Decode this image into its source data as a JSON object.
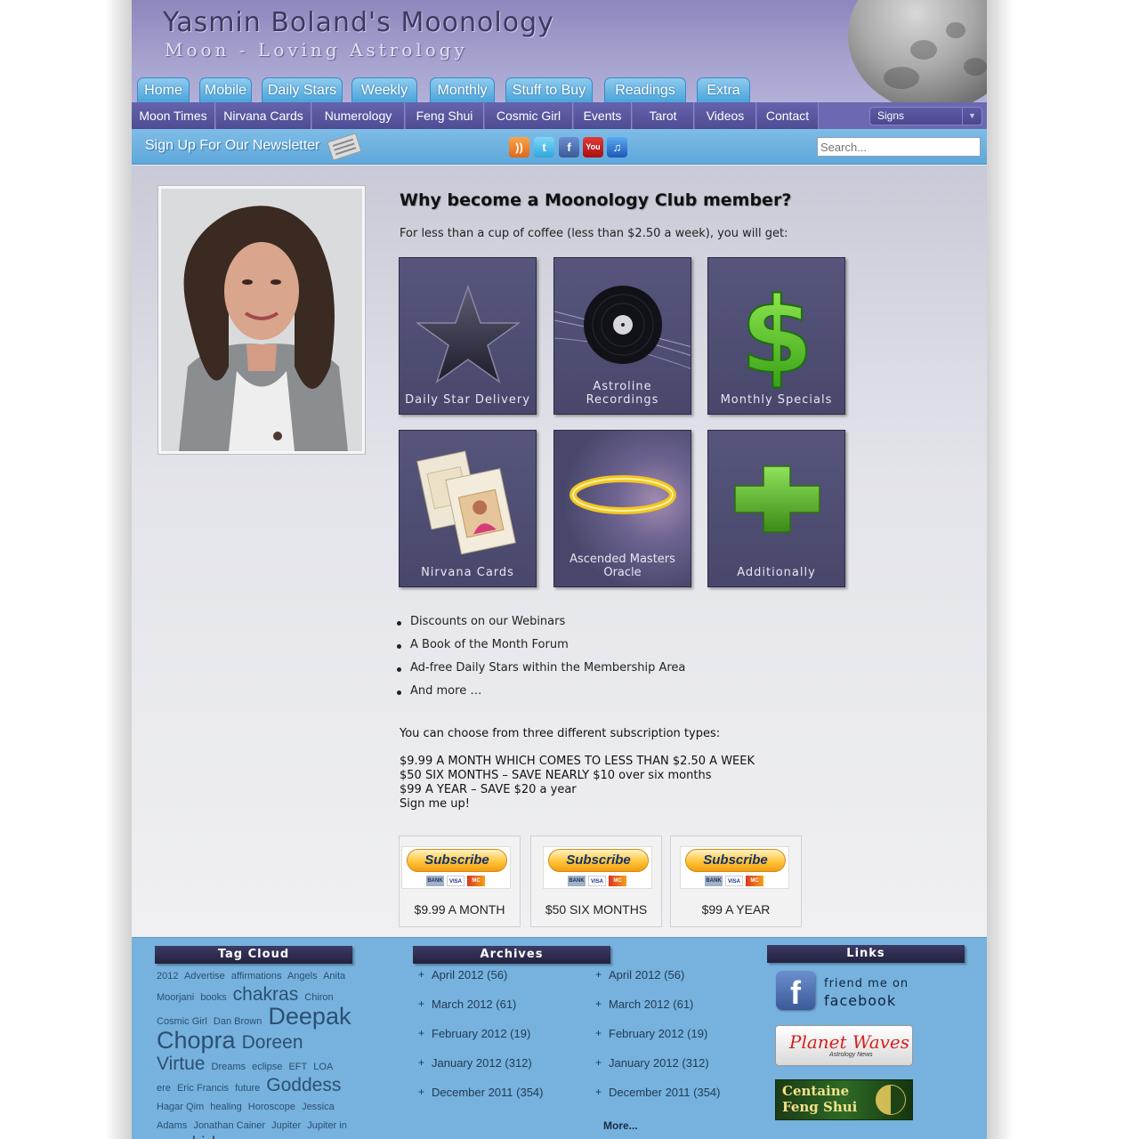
{
  "site": {
    "title": "Yasmin Boland's Moonology",
    "tagline": "Moon - Loving Astrology"
  },
  "main_tabs": [
    "Home",
    "Mobile",
    "Daily Stars",
    "Weekly",
    "Monthly",
    "Stuff to Buy",
    "Readings",
    "Extra"
  ],
  "sub_nav": [
    "Moon Times",
    "Nirvana Cards",
    "Numerology",
    "Feng Shui",
    "Cosmic Girl",
    "Events",
    "Tarot",
    "Videos",
    "Contact"
  ],
  "signs_select": {
    "selected": "Signs"
  },
  "newsletter": {
    "label": "Sign Up For Our Newsletter"
  },
  "social_icons": [
    "rss-icon",
    "twitter-icon",
    "facebook-icon",
    "youtube-icon",
    "itunes-icon"
  ],
  "search": {
    "placeholder": "Search..."
  },
  "content": {
    "heading": "Why become a Moonology Club member?",
    "intro": "For less than a cup of coffee (less than $2.50 a week), you will get:",
    "tiles": [
      {
        "label": "Daily Star Delivery",
        "icon": "star-icon"
      },
      {
        "label": "Astroline Recordings",
        "icon": "vinyl-record-icon"
      },
      {
        "label": "Monthly Specials",
        "icon": "dollar-sign-icon"
      },
      {
        "label": "Nirvana Cards",
        "icon": "cards-icon"
      },
      {
        "label": "Ascended Masters Oracle",
        "icon": "halo-icon"
      },
      {
        "label": "Additionally",
        "icon": "plus-icon"
      }
    ],
    "benefits": [
      "Discounts on our Webinars",
      "A Book of the Month Forum",
      "Ad-free Daily Stars within the Membership Area",
      "And more …"
    ],
    "choose_text": "You can choose from three different subscription types:",
    "price_lines": [
      "$9.99 A MONTH WHICH COMES TO LESS THAN $2.50 A WEEK",
      "$50 SIX MONTHS – SAVE NEARLY $10 over six months",
      "$99 A YEAR – SAVE $20 a year",
      "Sign me up!"
    ],
    "subscriptions": [
      {
        "button": "Subscribe",
        "label": "$9.99 A MONTH"
      },
      {
        "button": "Subscribe",
        "label": "$50 SIX MONTHS"
      },
      {
        "button": "Subscribe",
        "label": "$99 A YEAR"
      }
    ],
    "card_logos": [
      "BANK",
      "VISA",
      "MC"
    ]
  },
  "footer": {
    "tag_cloud_title": "Tag Cloud",
    "tags": [
      {
        "text": "2012",
        "size": 11
      },
      {
        "text": "Advertise",
        "size": 11
      },
      {
        "text": "affirmations",
        "size": 11
      },
      {
        "text": "Angels",
        "size": 11
      },
      {
        "text": "Anita Moorjani",
        "size": 11
      },
      {
        "text": "books",
        "size": 11
      },
      {
        "text": "chakras",
        "size": 21
      },
      {
        "text": "Chiron",
        "size": 11
      },
      {
        "text": "Cosmic Girl",
        "size": 11
      },
      {
        "text": "Dan Brown",
        "size": 11
      },
      {
        "text": "Deepak Chopra",
        "size": 27
      },
      {
        "text": "Doreen Virtue",
        "size": 21
      },
      {
        "text": "Dreams",
        "size": 11
      },
      {
        "text": "eclipse",
        "size": 11
      },
      {
        "text": "EFT",
        "size": 11
      },
      {
        "text": "LOA",
        "size": 11
      },
      {
        "text": "ere",
        "size": 11
      },
      {
        "text": "Eric Francis",
        "size": 11
      },
      {
        "text": "future",
        "size": 11
      },
      {
        "text": "Goddess",
        "size": 21
      },
      {
        "text": "Hagar Qim",
        "size": 11
      },
      {
        "text": "healing",
        "size": 11
      },
      {
        "text": "Horoscope",
        "size": 11
      },
      {
        "text": "Jessica Adams",
        "size": 11
      },
      {
        "text": "Jonathan Cainer",
        "size": 11
      },
      {
        "text": "Jupiter",
        "size": 11
      },
      {
        "text": "Jupiter in Pisces",
        "size": 11
      },
      {
        "text": "kids",
        "size": 21
      }
    ],
    "archives_title": "Archives",
    "archives_col1": [
      "April 2012 (56)",
      "March 2012 (61)",
      "February 2012 (19)",
      "January 2012 (312)",
      "December 2011 (354)"
    ],
    "archives_col2": [
      "April 2012 (56)",
      "March 2012 (61)",
      "February 2012 (19)",
      "January 2012 (312)",
      "December 2011 (354)"
    ],
    "more_label": "More...",
    "links_title": "Links",
    "facebook_line1": "friend me on",
    "facebook_line2": "facebook",
    "planet_waves_title": "Planet Waves",
    "planet_waves_sub": "Astrology News",
    "feng_shui_line1": "Centaine",
    "feng_shui_line2": "Feng Shui"
  }
}
